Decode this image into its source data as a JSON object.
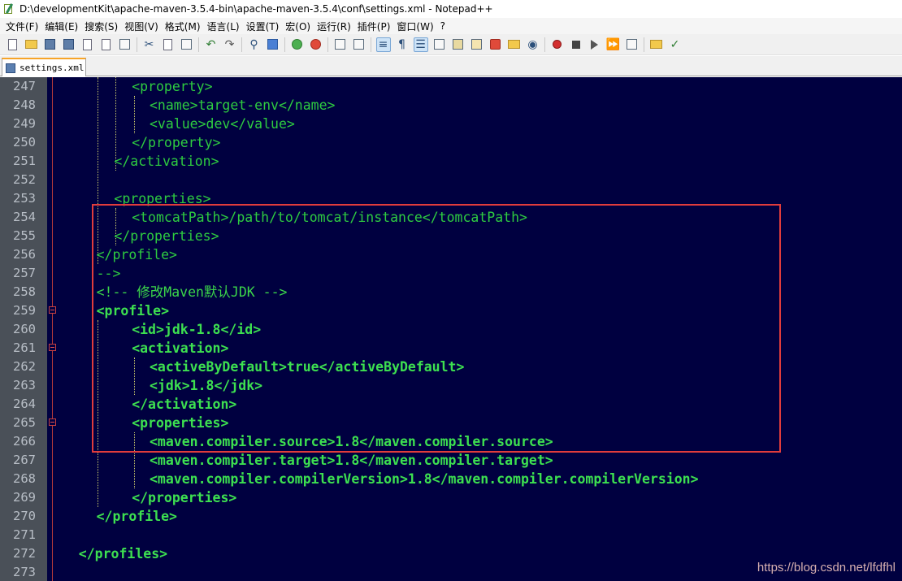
{
  "window": {
    "title": "D:\\developmentKit\\apache-maven-3.5.4-bin\\apache-maven-3.5.4\\conf\\settings.xml - Notepad++"
  },
  "menu": [
    "文件(F)",
    "编辑(E)",
    "搜索(S)",
    "视图(V)",
    "格式(M)",
    "语言(L)",
    "设置(T)",
    "宏(O)",
    "运行(R)",
    "插件(P)",
    "窗口(W)",
    "?"
  ],
  "tab": {
    "label": "settings.xml"
  },
  "editor": {
    "lines": [
      {
        "no": "247",
        "text": "<property>",
        "indent": 8,
        "style": "normal"
      },
      {
        "no": "248",
        "text": "<name>target-env</name>",
        "indent": 10,
        "style": "normal"
      },
      {
        "no": "249",
        "text": "<value>dev</value>",
        "indent": 10,
        "style": "normal"
      },
      {
        "no": "250",
        "text": "</property>",
        "indent": 8,
        "style": "normal"
      },
      {
        "no": "251",
        "text": "</activation>",
        "indent": 6,
        "style": "normal"
      },
      {
        "no": "252",
        "text": "",
        "indent": 0,
        "style": "normal"
      },
      {
        "no": "253",
        "text": "<properties>",
        "indent": 6,
        "style": "normal"
      },
      {
        "no": "254",
        "text": "<tomcatPath>/path/to/tomcat/instance</tomcatPath>",
        "indent": 8,
        "style": "normal"
      },
      {
        "no": "255",
        "text": "</properties>",
        "indent": 6,
        "style": "normal"
      },
      {
        "no": "256",
        "text": "</profile>",
        "indent": 4,
        "style": "normal"
      },
      {
        "no": "257",
        "text": "-->",
        "indent": 4,
        "style": "normal"
      },
      {
        "no": "258",
        "text": "<!-- 修改Maven默认JDK -->",
        "indent": 4,
        "style": "comment"
      },
      {
        "no": "259",
        "text": "<profile>",
        "indent": 4,
        "style": "bold"
      },
      {
        "no": "260",
        "text": "<id>jdk-1.8</id>",
        "indent": 8,
        "style": "bold"
      },
      {
        "no": "261",
        "text": "<activation>",
        "indent": 8,
        "style": "bold"
      },
      {
        "no": "262",
        "text": "<activeByDefault>true</activeByDefault>",
        "indent": 10,
        "style": "bold"
      },
      {
        "no": "263",
        "text": "<jdk>1.8</jdk>",
        "indent": 10,
        "style": "bold"
      },
      {
        "no": "264",
        "text": "</activation>",
        "indent": 8,
        "style": "bold"
      },
      {
        "no": "265",
        "text": "<properties>",
        "indent": 8,
        "style": "bold"
      },
      {
        "no": "266",
        "text": "<maven.compiler.source>1.8</maven.compiler.source>",
        "indent": 10,
        "style": "bold"
      },
      {
        "no": "267",
        "text": "<maven.compiler.target>1.8</maven.compiler.target>",
        "indent": 10,
        "style": "bold"
      },
      {
        "no": "268",
        "text": "<maven.compiler.compilerVersion>1.8</maven.compiler.compilerVersion>",
        "indent": 10,
        "style": "bold"
      },
      {
        "no": "269",
        "text": "</properties>",
        "indent": 8,
        "style": "bold"
      },
      {
        "no": "270",
        "text": "</profile>",
        "indent": 4,
        "style": "bold"
      },
      {
        "no": "271",
        "text": "",
        "indent": 0,
        "style": "normal"
      },
      {
        "no": "272",
        "text": "</profiles>",
        "indent": 2,
        "style": "bold"
      },
      {
        "no": "273",
        "text": "",
        "indent": 0,
        "style": "normal"
      }
    ]
  },
  "watermark": "https://blog.csdn.net/lfdfhl",
  "colors": {
    "editor_bg": "#000040",
    "code_green": "#2ecc40",
    "gutter_bg": "#4a5058",
    "highlight_border": "#e03c3c",
    "tab_accent": "#f7a428"
  }
}
